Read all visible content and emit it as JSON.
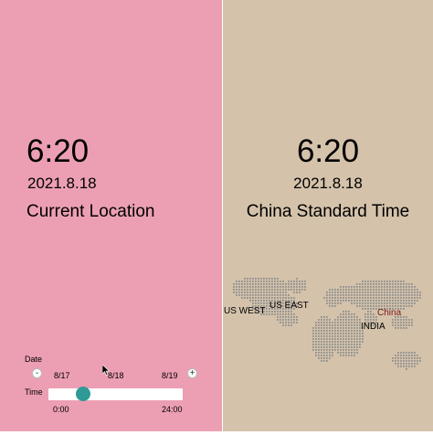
{
  "local": {
    "time": "6:20",
    "date": "2021.8.18",
    "zone": "Current Location"
  },
  "remote": {
    "time": "6:20",
    "date": "2021.8.18",
    "zone": "China Standard Time"
  },
  "map": {
    "labels": {
      "us_west": "US WEST",
      "us_east": "US EAST",
      "china": "China",
      "india": "INDIA"
    }
  },
  "controls": {
    "date_label": "Date",
    "date_minus": "-",
    "date_plus": "+",
    "date_ticks": [
      "8/17",
      "8/18",
      "8/19"
    ],
    "time_label": "Time",
    "time_min": "0:00",
    "time_max": "24:00",
    "time_value_fraction": 0.26
  },
  "colors": {
    "left_bg": "#ec9fb3",
    "right_bg": "#d4c2aa",
    "thumb": "#2e9a96",
    "map_dots": "#8f8f8f"
  }
}
